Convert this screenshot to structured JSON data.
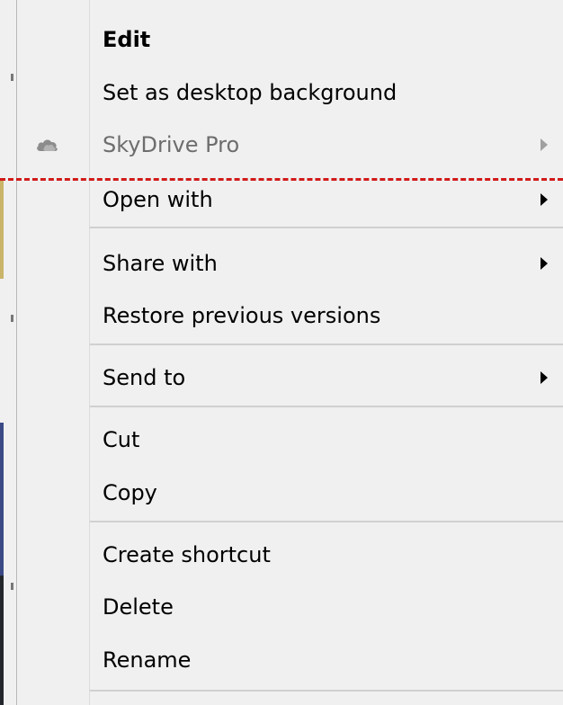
{
  "menu": {
    "items": [
      {
        "label": "Edit",
        "bold": true
      },
      {
        "label": "Set as desktop background"
      },
      {
        "label": "SkyDrive Pro",
        "disabled": true,
        "submenu": true,
        "icon": "cloud-icon"
      },
      {
        "label": "Open with",
        "submenu": true
      },
      {
        "label": "Share with",
        "submenu": true
      },
      {
        "label": "Restore previous versions"
      },
      {
        "label": "Send to",
        "submenu": true
      },
      {
        "label": "Cut"
      },
      {
        "label": "Copy"
      },
      {
        "label": "Create shortcut"
      },
      {
        "label": "Delete"
      },
      {
        "label": "Rename"
      }
    ]
  },
  "colors": {
    "menu_bg": "#f0f0f0",
    "disabled_text": "#6d6d6d",
    "highlight_line": "#d11a1a"
  }
}
